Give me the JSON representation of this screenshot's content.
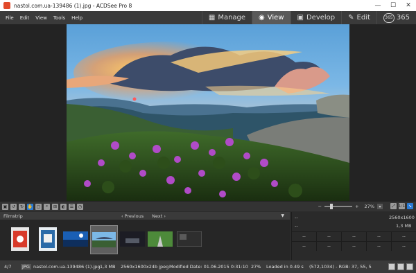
{
  "window": {
    "title": "nastol.com.ua-139486 (1).jpg - ACDSee Pro 8",
    "controls": {
      "minimize": "—",
      "maximize": "☐",
      "close": "✕"
    }
  },
  "menu": [
    "File",
    "Edit",
    "View",
    "Tools",
    "Help"
  ],
  "modes": [
    {
      "label": "Manage",
      "icon": "grid-icon",
      "active": false
    },
    {
      "label": "View",
      "icon": "eye-icon",
      "active": true
    },
    {
      "label": "Develop",
      "icon": "develop-icon",
      "active": false
    },
    {
      "label": "Edit",
      "icon": "edit-icon",
      "active": false
    },
    {
      "label": "365",
      "icon": "365-icon",
      "active": false
    }
  ],
  "toolbar": {
    "zoom_minus": "−",
    "zoom_plus": "+",
    "zoom_value": "27%",
    "zoom_fraction": 0.27
  },
  "filmstrip": {
    "label": "Filmstrip",
    "previous": "‹ Previous",
    "next": "Next ›",
    "caret": "▼"
  },
  "properties": {
    "dim": "2560x1600",
    "size": "1,3 MB",
    "left1": "--",
    "left2": "--",
    "grid": [
      "--",
      "--",
      "--",
      "--",
      "--",
      "--",
      "--",
      "--",
      "--",
      "--"
    ]
  },
  "status": {
    "index": "4/7",
    "type": "JPG",
    "filename": "nastol.com.ua-139486 (1).jpg",
    "filesize": "1,3 MB",
    "dimensions": "2560x1600x24b jpeg",
    "modified": "Modified Date: 01.06.2015 0:31:10",
    "zoom": "27%",
    "loaded": "Loaded in 0.49 s",
    "pixel": "(572,1034) - RGB: 37, 55, 5"
  },
  "colors": {
    "accent": "#2a7bd5",
    "panel": "#2b2b2b"
  }
}
